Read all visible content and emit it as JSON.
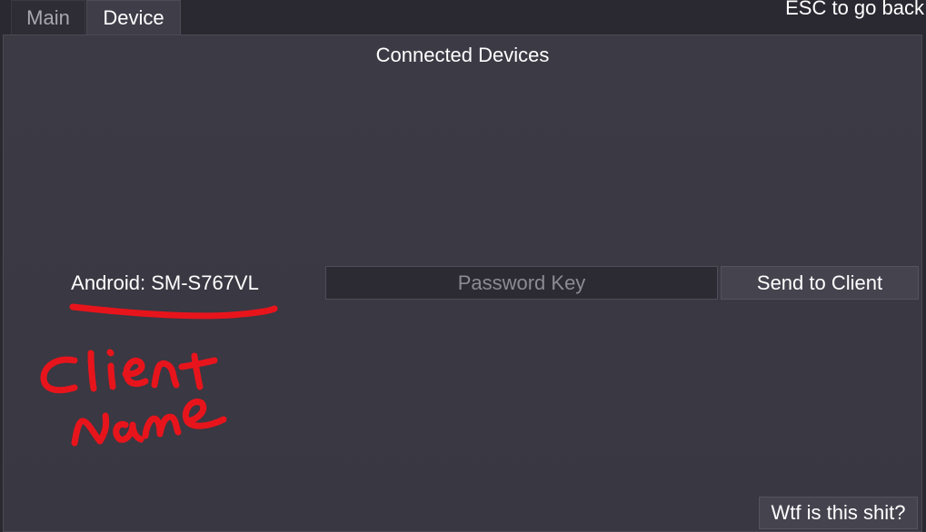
{
  "tabs": [
    {
      "label": "Main",
      "active": false
    },
    {
      "label": "Device",
      "active": true
    }
  ],
  "header": {
    "esc_hint": "ESC to go back"
  },
  "panel": {
    "title": "Connected Devices"
  },
  "devices": [
    {
      "name": "Android: SM-S767VL",
      "password_placeholder": "Password Key",
      "password_value": "",
      "send_label": "Send to Client"
    }
  ],
  "help": {
    "label": "Wtf is this shit?"
  },
  "annotation": {
    "text": "Client name",
    "color": "#e8141c"
  },
  "colors": {
    "background": "#2a2830",
    "panel": "#3b3943",
    "button": "#45434e",
    "input": "#2c2a32",
    "placeholder": "#8c8a93"
  }
}
